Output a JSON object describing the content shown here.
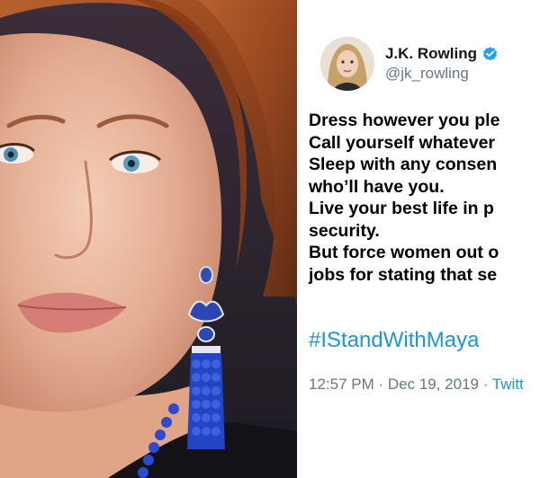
{
  "photo": {
    "description_icon": "portrait-photo"
  },
  "tweet": {
    "author": {
      "display_name": "J.K. Rowling",
      "handle": "@jk_rowling",
      "verified": true,
      "verified_color": "#1da1f2"
    },
    "lines": [
      "Dress however you ple",
      "Call yourself whatever",
      "Sleep with any consen",
      "who’ll have you.",
      "Live your best life in p",
      "security.",
      "But force women out o",
      "jobs for stating that se"
    ],
    "hashtag": "#IStandWithMaya",
    "timestamp": "12:57 PM · Dec 19, 2019 · ",
    "source": "Twitt",
    "colors": {
      "link": "#1b95e0",
      "secondary": "#657786",
      "text": "#000000"
    }
  }
}
